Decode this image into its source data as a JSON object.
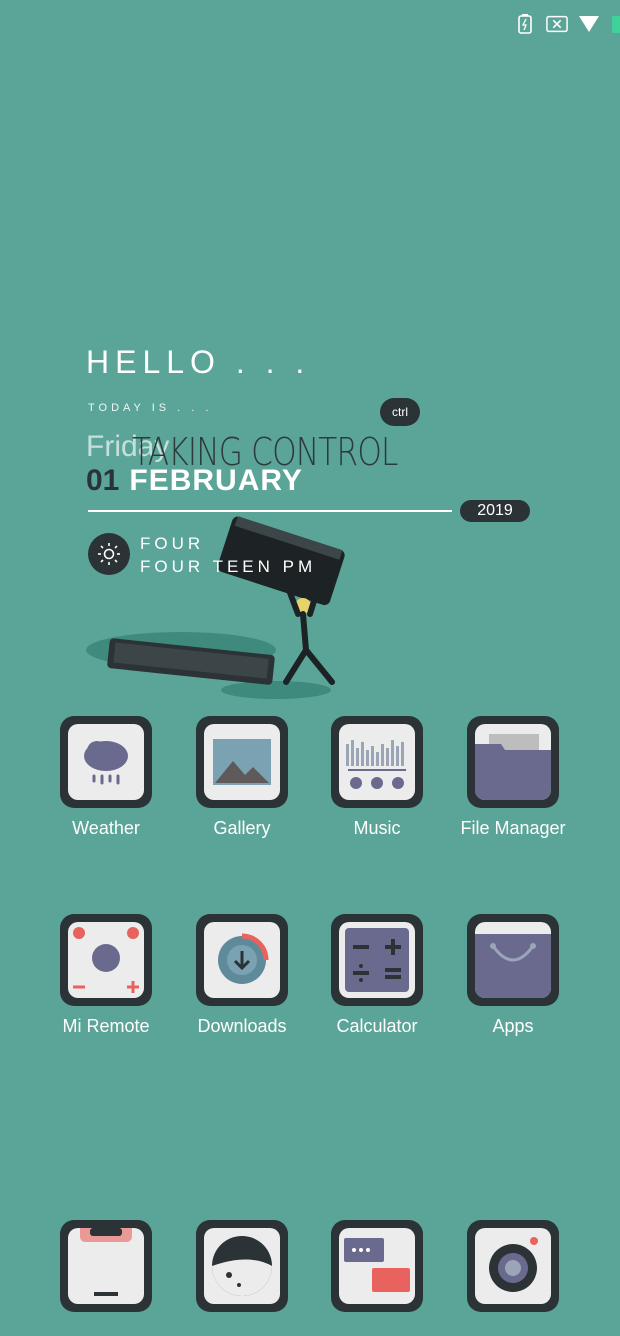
{
  "status_bar": {
    "icons": [
      "battery-icon",
      "no-sim-icon",
      "wifi-icon",
      "battery-level-icon"
    ]
  },
  "widget": {
    "greeting": "HELLO . . .",
    "today_label": "TODAY IS . . .",
    "day": "Friday",
    "overlay_text": "TAKING CONTROL",
    "bubble": "ctrl",
    "date_num": "01",
    "month": "FEBRUARY",
    "year": "2019",
    "time_line1": "FOUR",
    "time_line2": "FOUR TEEN PM"
  },
  "apps_row1": [
    {
      "label": "Weather",
      "icon": "weather-icon"
    },
    {
      "label": "Gallery",
      "icon": "gallery-icon"
    },
    {
      "label": "Music",
      "icon": "music-icon"
    },
    {
      "label": "File Manager",
      "icon": "folder-icon"
    }
  ],
  "apps_row2": [
    {
      "label": "Mi Remote",
      "icon": "remote-icon"
    },
    {
      "label": "Downloads",
      "icon": "download-icon"
    },
    {
      "label": "Calculator",
      "icon": "calculator-icon"
    },
    {
      "label": "Apps",
      "icon": "store-icon"
    }
  ],
  "dock": [
    {
      "icon": "phone-icon"
    },
    {
      "icon": "browser-icon"
    },
    {
      "icon": "messages-icon"
    },
    {
      "icon": "camera-icon"
    }
  ],
  "colors": {
    "background": "#5ba598",
    "dark": "#2b3336",
    "tile": "#ececec",
    "accent_red": "#e8625e",
    "purple": "#6a6a8e"
  }
}
